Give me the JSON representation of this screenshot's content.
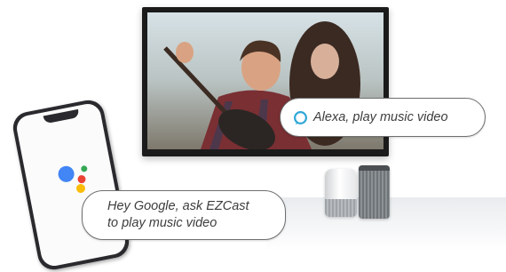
{
  "bubbles": {
    "alexa_text": "Alexa, play music video",
    "google_line1": "Hey Google, ask EZCast",
    "google_line2": "to play music video"
  },
  "icons": {
    "alexa": "alexa-ring-icon",
    "assistant": "google-assistant-icon"
  },
  "colors": {
    "alexa_blue": "#31a8d8",
    "google_blue": "#4285f4",
    "google_red": "#ea4335",
    "google_yellow": "#fbbc05",
    "google_green": "#34a853"
  }
}
